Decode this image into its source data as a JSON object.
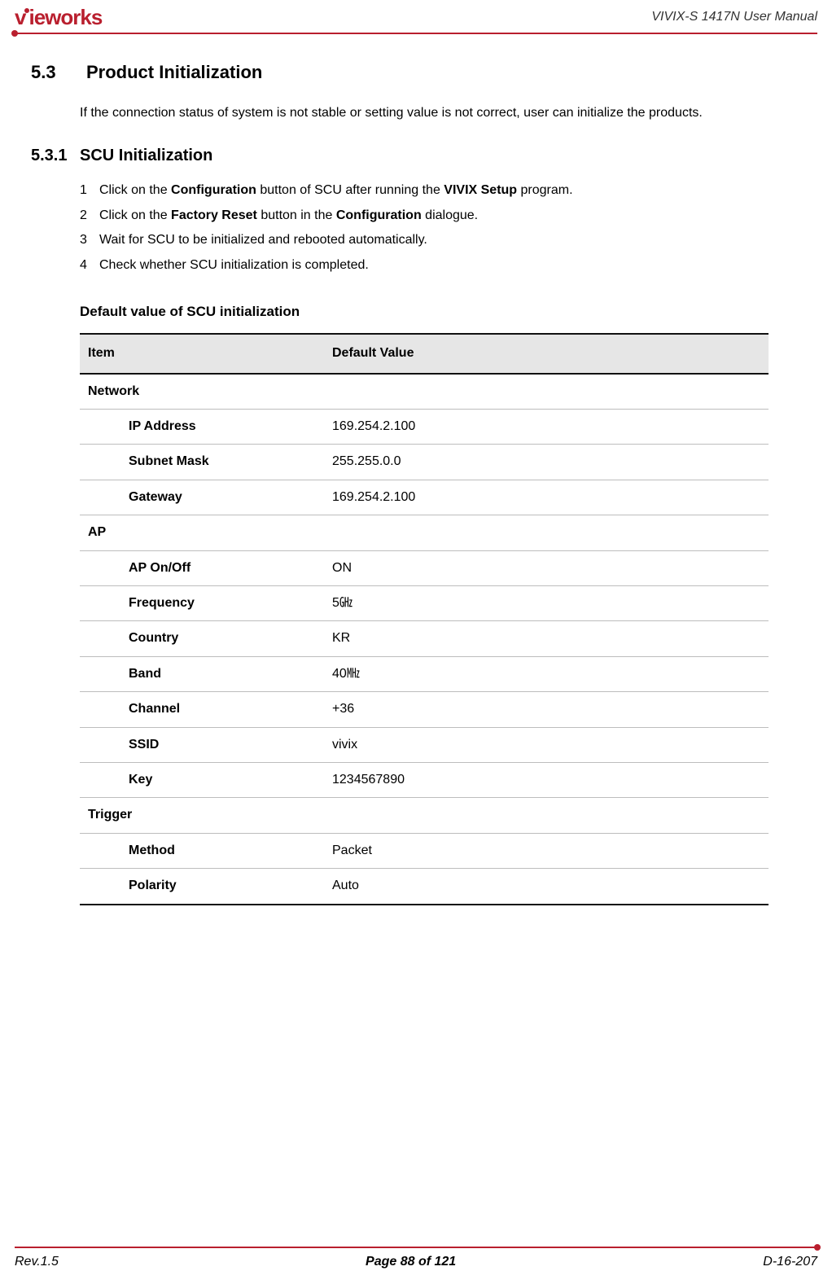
{
  "header": {
    "logo_text": "VIEWORKS",
    "doc_title": "VIVIX-S 1417N User Manual"
  },
  "section": {
    "number": "5.3",
    "title": "Product Initialization",
    "intro": "If the connection status of system is not stable or setting value is not correct, user can initialize the products."
  },
  "subsection": {
    "number": "5.3.1",
    "title": "SCU Initialization",
    "steps": [
      {
        "n": "1",
        "prefix": "Click on the ",
        "b1": "Configuration",
        "mid": " button of SCU after running the ",
        "b2": "VIVIX Setup",
        "suffix": " program."
      },
      {
        "n": "2",
        "prefix": "Click on the ",
        "b1": "Factory Reset",
        "mid": " button in the ",
        "b2": "Configuration",
        "suffix": " dialogue."
      },
      {
        "n": "3",
        "prefix": "Wait for SCU to be initialized and rebooted automatically.",
        "b1": "",
        "mid": "",
        "b2": "",
        "suffix": ""
      },
      {
        "n": "4",
        "prefix": "Check whether SCU initialization is completed.",
        "b1": "",
        "mid": "",
        "b2": "",
        "suffix": ""
      }
    ]
  },
  "table": {
    "title": "Default value of SCU initialization",
    "head": {
      "c1": "Item",
      "c2": "Default Value"
    },
    "groups": [
      {
        "name": "Network",
        "rows": [
          {
            "item": "IP Address",
            "value": "169.254.2.100"
          },
          {
            "item": "Subnet Mask",
            "value": "255.255.0.0"
          },
          {
            "item": "Gateway",
            "value": "169.254.2.100"
          }
        ]
      },
      {
        "name": "AP",
        "rows": [
          {
            "item": "AP On/Off",
            "value": "ON"
          },
          {
            "item": "Frequency",
            "value": "5㎓"
          },
          {
            "item": "Country",
            "value": "KR"
          },
          {
            "item": "Band",
            "value": "40㎒"
          },
          {
            "item": "Channel",
            "value": "+36"
          },
          {
            "item": "SSID",
            "value": "vivix"
          },
          {
            "item": "Key",
            "value": "1234567890"
          }
        ]
      },
      {
        "name": "Trigger",
        "rows": [
          {
            "item": "Method",
            "value": "Packet"
          },
          {
            "item": "Polarity",
            "value": "Auto"
          }
        ]
      }
    ]
  },
  "footer": {
    "rev": "Rev.1.5",
    "page": "Page 88 of 121",
    "docnum": "D-16-207"
  }
}
